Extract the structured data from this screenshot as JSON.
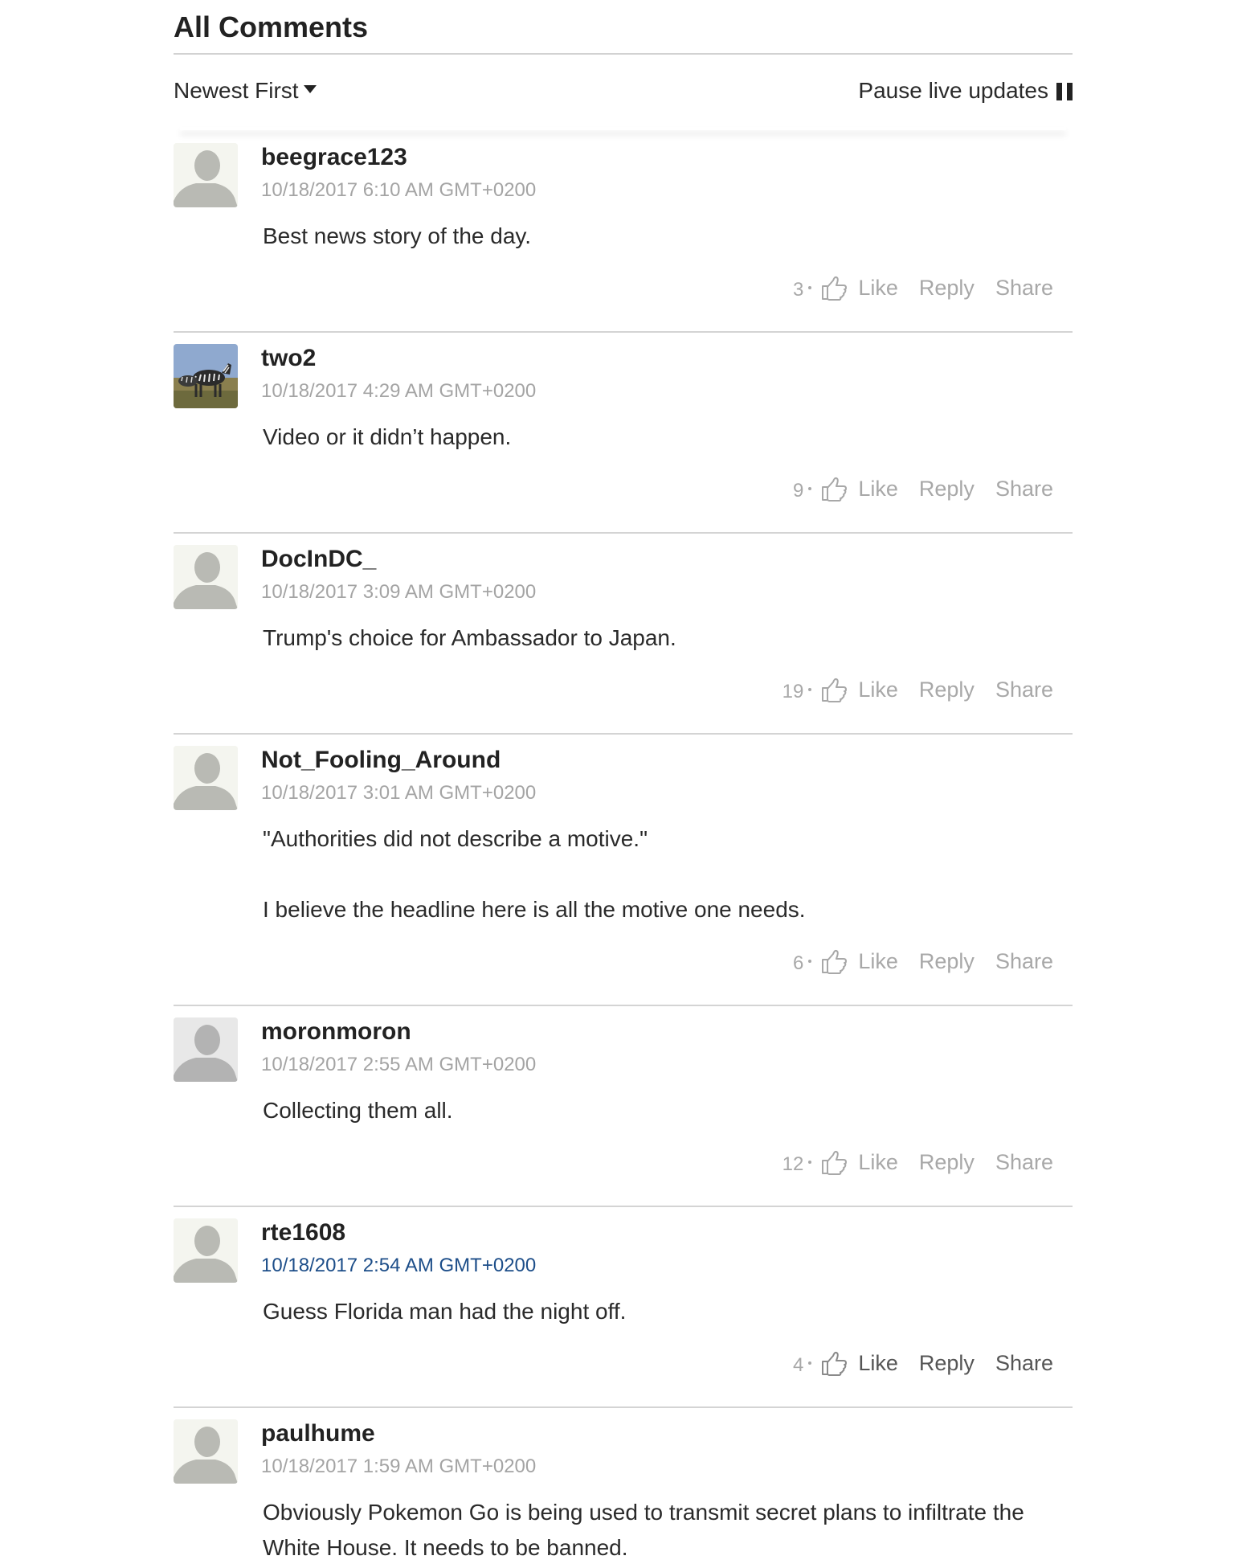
{
  "header": {
    "title": "All Comments",
    "sort_label": "Newest First",
    "pause_label": "Pause live updates"
  },
  "actions_labels": {
    "like": "Like",
    "reply": "Reply",
    "share": "Share"
  },
  "comments": [
    {
      "author": "beegrace123",
      "timestamp": "10/18/2017 6:10 AM GMT+0200",
      "paragraphs": [
        "Best news story of the day."
      ],
      "likes": "3",
      "avatar": "default-avatar"
    },
    {
      "author": "two2",
      "timestamp": "10/18/2017 4:29 AM GMT+0200",
      "paragraphs": [
        "Video or it didn’t happen."
      ],
      "likes": "9",
      "avatar": "zebra-photo"
    },
    {
      "author": "DocInDC_",
      "timestamp": "10/18/2017 3:09 AM GMT+0200",
      "paragraphs": [
        "Trump's choice for Ambassador to Japan."
      ],
      "likes": "19",
      "avatar": "default-avatar"
    },
    {
      "author": "Not_Fooling_Around",
      "timestamp": "10/18/2017 3:01 AM GMT+0200",
      "paragraphs": [
        "\"Authorities did not describe a motive.\"",
        "I believe the headline here is all the motive one needs."
      ],
      "likes": "6",
      "avatar": "default-avatar"
    },
    {
      "author": "moronmoron",
      "timestamp": "10/18/2017 2:55 AM GMT+0200",
      "paragraphs": [
        "Collecting them all."
      ],
      "likes": "12",
      "avatar": "default-avatar-gray"
    },
    {
      "author": "rte1608",
      "timestamp": "10/18/2017 2:54 AM GMT+0200",
      "paragraphs": [
        "Guess Florida man had the night off."
      ],
      "likes": "4",
      "avatar": "default-avatar"
    },
    {
      "author": "paulhume",
      "timestamp": "10/18/2017 1:59 AM GMT+0200",
      "paragraphs": [
        "Obviously Pokemon Go is being used to transmit secret plans to infiltrate the",
        "White House. It needs to be banned."
      ],
      "likes": "",
      "avatar": "default-avatar"
    }
  ],
  "colors": {
    "text": "#222222",
    "muted": "#a4a4a4",
    "link": "#1d4e89",
    "divider": "#d4d4d4"
  }
}
